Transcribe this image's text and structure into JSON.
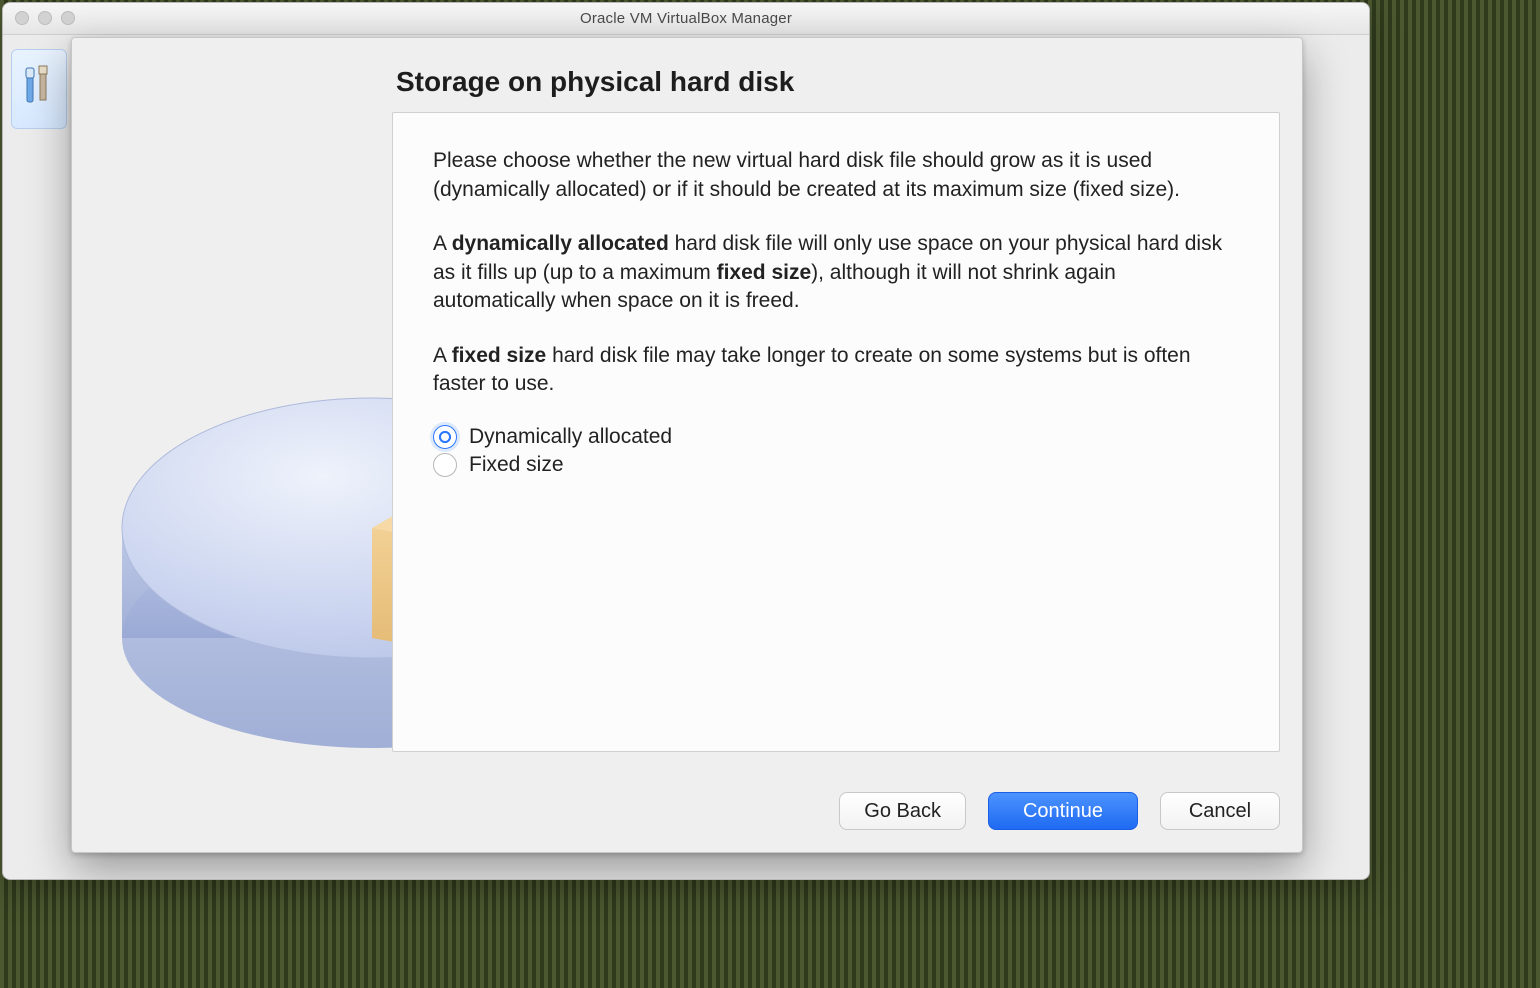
{
  "window": {
    "title": "Oracle VM VirtualBox Manager"
  },
  "wizard": {
    "title": "Storage on physical hard disk",
    "paragraph1": "Please choose whether the new virtual hard disk file should grow as it is used (dynamically allocated) or if it should be created at its maximum size (fixed size).",
    "p2_prefix": "A ",
    "p2_bold": "dynamically allocated",
    "p2_mid": " hard disk file will only use space on your physical hard disk as it fills up (up to a maximum ",
    "p2_bold2": "fixed size",
    "p2_suffix": "), although it will not shrink again automatically when space on it is freed.",
    "p3_prefix": "A ",
    "p3_bold": "fixed size",
    "p3_suffix": " hard disk file may take longer to create on some systems but is often faster to use.",
    "options": {
      "dynamic": "Dynamically allocated",
      "fixed": "Fixed size"
    },
    "buttons": {
      "back": "Go Back",
      "continue": "Continue",
      "cancel": "Cancel"
    }
  }
}
